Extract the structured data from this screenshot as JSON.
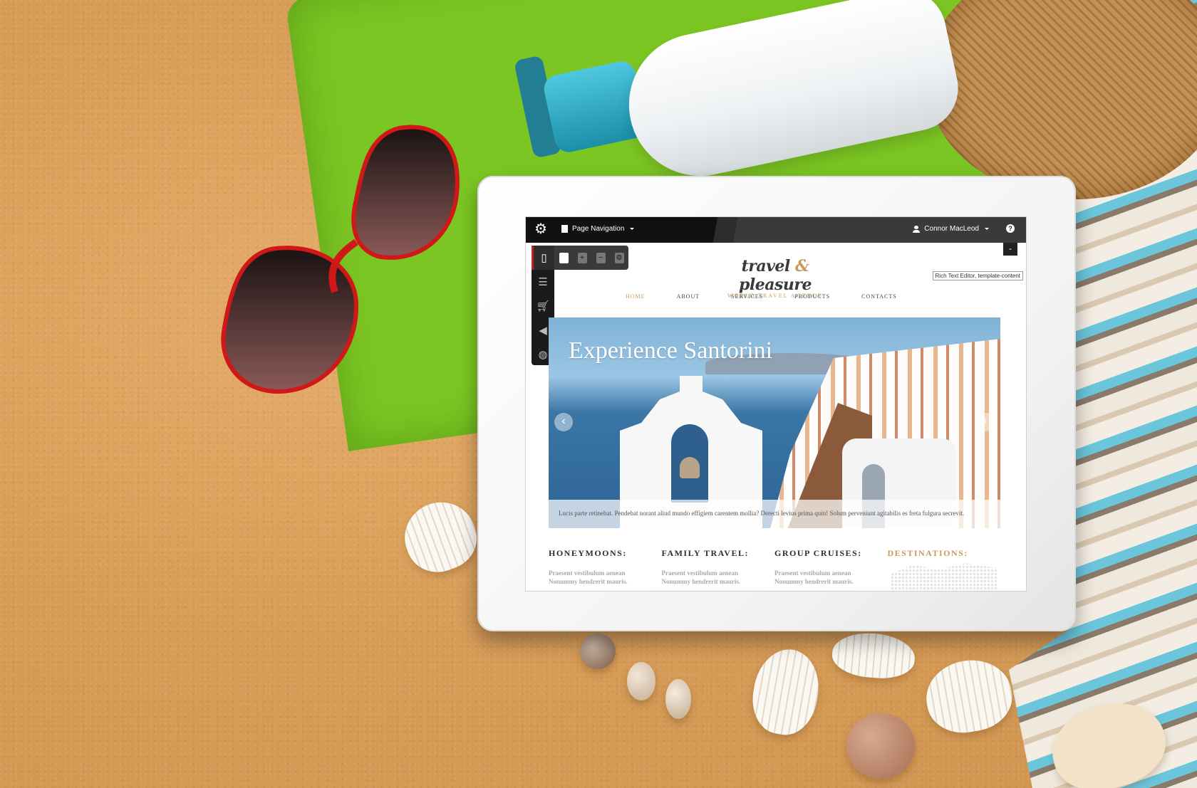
{
  "toolbar": {
    "page_navigation_label": "Page Navigation",
    "user_name": "Connor MacLeod",
    "help_label": "?",
    "collapse_label": "-"
  },
  "sidebar": {
    "items": [
      {
        "icon": "page-icon",
        "active": true
      },
      {
        "icon": "list-icon",
        "active": false
      },
      {
        "icon": "cart-icon",
        "active": false
      },
      {
        "icon": "megaphone-icon",
        "active": false
      },
      {
        "icon": "globe-icon",
        "active": false
      }
    ],
    "sub_tools": [
      {
        "icon": "add-page-icon",
        "glyph": "+"
      },
      {
        "icon": "remove-page-icon",
        "glyph": "−"
      },
      {
        "icon": "page-settings-icon",
        "glyph": "⚙"
      }
    ]
  },
  "site": {
    "brand_left": "travel",
    "brand_amp": "&",
    "brand_right": "pleasure",
    "tagline": "WORLD TRAVEL AGENCY",
    "editor_tooltip": "Rich Text Editor, template-content",
    "nav": [
      "HOME",
      "ABOUT",
      "SERVICES",
      "PRODUCTS",
      "CONTACTS"
    ],
    "hero": {
      "title": "Experience Santorini",
      "caption": "Lucis parte retinebat. Pendebat norant aliud mundo effigiem carentem mollia? Derecti levius prima quin! Solum perveniunt agitabilis es freta fulgura secrevit."
    },
    "features": [
      {
        "title": "HONEYMOONS:",
        "line1": "Praesent vestibulum aenean",
        "line2": "Nonummy hendrerit mauris."
      },
      {
        "title": "FAMILY TRAVEL:",
        "line1": "Praesent vestibulum aenean",
        "line2": "Nonummy hendrerit mauris."
      },
      {
        "title": "GROUP CRUISES:",
        "line1": "Praesent vestibulum aenean",
        "line2": "Nonummy hendrerit mauris."
      },
      {
        "title": "DESTINATIONS:",
        "line1": "",
        "line2": ""
      }
    ]
  },
  "colors": {
    "accent": "#c79a5a",
    "toolbar": "#111111",
    "active_marker": "#c21f1f",
    "towel": "#7cc623"
  }
}
